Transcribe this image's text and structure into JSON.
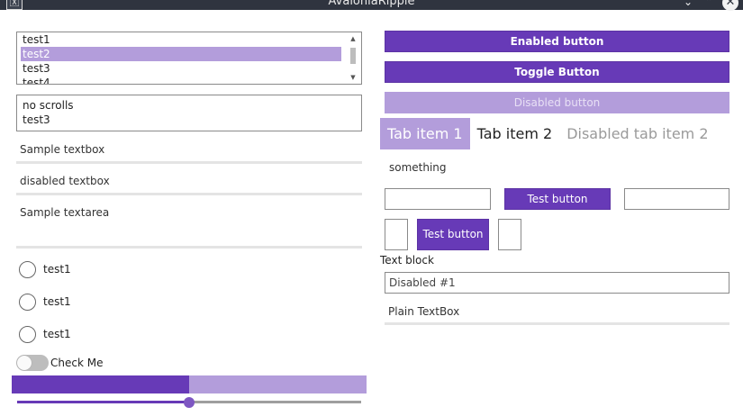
{
  "window": {
    "title": "AvaloniaRipple",
    "icon_glyph": "🅇",
    "minimize_glyph": "⌄",
    "maximize_glyph": "⌃",
    "close_glyph": "✕"
  },
  "listbox": {
    "items": [
      "test1",
      "test2",
      "test3",
      "test4"
    ],
    "selected_index": 1,
    "scroll_up_glyph": "▲",
    "scroll_down_glyph": "▼"
  },
  "listbox_noscroll": {
    "items": [
      "no scrolls",
      "test3"
    ]
  },
  "textboxes": {
    "sample": "Sample textbox",
    "disabled": "disabled textbox",
    "textarea": "Sample textarea"
  },
  "radios": [
    {
      "label": "test1"
    },
    {
      "label": "test1"
    },
    {
      "label": "test1"
    }
  ],
  "toggle": {
    "label": "Check Me",
    "checked": false
  },
  "progress": {
    "value_percent": 50
  },
  "slider": {
    "value_percent": 50
  },
  "buttons": {
    "enabled": "Enabled button",
    "toggle": "Toggle Button",
    "disabled": "Disabled button",
    "test1": "Test button",
    "test2": "Test button"
  },
  "tabs": [
    {
      "label": "Tab item 1",
      "state": "active"
    },
    {
      "label": "Tab item 2",
      "state": "normal"
    },
    {
      "label": "Disabled tab item 2",
      "state": "disabled"
    }
  ],
  "tab_content": "something",
  "text_block": "Text block",
  "disabled_field": "Disabled #1",
  "plain_textbox": "Plain TextBox",
  "colors": {
    "accent": "#673ab7",
    "accent_light": "#b39ddb",
    "titlebar": "#2f343f"
  }
}
